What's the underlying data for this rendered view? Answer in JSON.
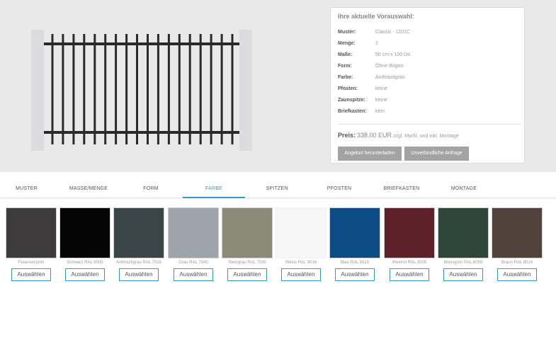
{
  "summary": {
    "title": "Ihre aktuelle Vorauswahl:",
    "rows": [
      {
        "key": "Muster:",
        "value": "Classic - 1101C"
      },
      {
        "key": "Menge:",
        "value": "1"
      },
      {
        "key": "Maße:",
        "value": "50 cm x 100 cm"
      },
      {
        "key": "Form:",
        "value": "Ohne Bogen"
      },
      {
        "key": "Farbe:",
        "value": "Anthrazitgrau"
      },
      {
        "key": "Pfosten:",
        "value": "keine"
      },
      {
        "key": "Zaunspitze:",
        "value": "keine"
      },
      {
        "key": "Briefkasten:",
        "value": "kein"
      }
    ],
    "price_label": "Preis:",
    "price_value": "338.00 EUR",
    "price_note": "zzgl. MwSt. und inkl. Montage",
    "download_label": "Angebot herunterladen",
    "request_label": "Unverbindliche Anfrage"
  },
  "tabs": [
    {
      "label": "MUSTER"
    },
    {
      "label": "MASSE/MENGE"
    },
    {
      "label": "FORM"
    },
    {
      "label": "FARBE",
      "active": true
    },
    {
      "label": "SPITZEN"
    },
    {
      "label": "PFOSTEN"
    },
    {
      "label": "BRIEFKASTEN"
    },
    {
      "label": "MONTAGE"
    }
  ],
  "colors": [
    {
      "name": "Feuerverzinkt",
      "hex": "#3d3b3c"
    },
    {
      "name": "Schwarz RAL 9005",
      "hex": "#050505"
    },
    {
      "name": "Anthrazitgrau RAL 7016",
      "hex": "#3b4447"
    },
    {
      "name": "Grau RAL 7040",
      "hex": "#9da4ab"
    },
    {
      "name": "Steingrau RAL 7030",
      "hex": "#8c8b79"
    },
    {
      "name": "Weiss RAL 9016",
      "hex": "#f7f7f7"
    },
    {
      "name": "Blau RAL 5010",
      "hex": "#0e4c85"
    },
    {
      "name": "Weinrot RAL 3005",
      "hex": "#5e2029"
    },
    {
      "name": "Moosgrün RAL 6005",
      "hex": "#2e473a"
    },
    {
      "name": "Braun RAL 8014",
      "hex": "#51433b"
    }
  ],
  "select_label": "Auswählen",
  "theme": {
    "accent": "#2e9bc6",
    "fence": "#2a2a2a",
    "post": "#dcdce0"
  }
}
